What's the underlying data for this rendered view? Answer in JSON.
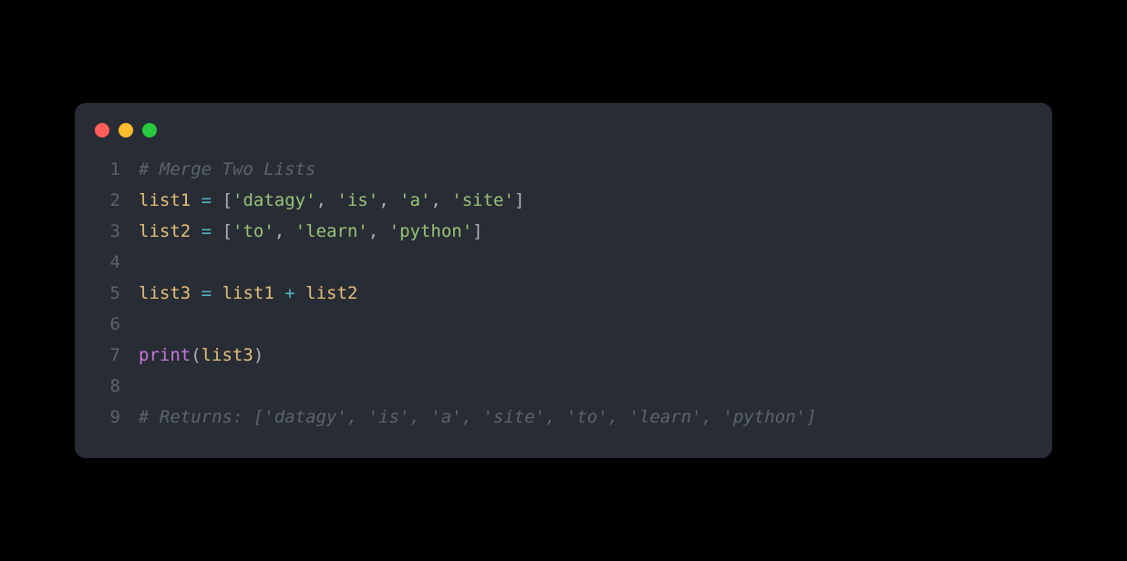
{
  "window": {
    "traffic_lights": [
      "red",
      "yellow",
      "green"
    ]
  },
  "code": {
    "lines": [
      {
        "number": "1",
        "tokens": [
          {
            "type": "comment",
            "text": "# Merge Two Lists"
          }
        ]
      },
      {
        "number": "2",
        "tokens": [
          {
            "type": "variable",
            "text": "list1"
          },
          {
            "type": "plain",
            "text": " "
          },
          {
            "type": "operator",
            "text": "="
          },
          {
            "type": "plain",
            "text": " "
          },
          {
            "type": "bracket",
            "text": "["
          },
          {
            "type": "string",
            "text": "'datagy'"
          },
          {
            "type": "punct",
            "text": ", "
          },
          {
            "type": "string",
            "text": "'is'"
          },
          {
            "type": "punct",
            "text": ", "
          },
          {
            "type": "string",
            "text": "'a'"
          },
          {
            "type": "punct",
            "text": ", "
          },
          {
            "type": "string",
            "text": "'site'"
          },
          {
            "type": "bracket",
            "text": "]"
          }
        ]
      },
      {
        "number": "3",
        "tokens": [
          {
            "type": "variable",
            "text": "list2"
          },
          {
            "type": "plain",
            "text": " "
          },
          {
            "type": "operator",
            "text": "="
          },
          {
            "type": "plain",
            "text": " "
          },
          {
            "type": "bracket",
            "text": "["
          },
          {
            "type": "string",
            "text": "'to'"
          },
          {
            "type": "punct",
            "text": ", "
          },
          {
            "type": "string",
            "text": "'learn'"
          },
          {
            "type": "punct",
            "text": ", "
          },
          {
            "type": "string",
            "text": "'python'"
          },
          {
            "type": "bracket",
            "text": "]"
          }
        ]
      },
      {
        "number": "4",
        "tokens": []
      },
      {
        "number": "5",
        "tokens": [
          {
            "type": "variable",
            "text": "list3"
          },
          {
            "type": "plain",
            "text": " "
          },
          {
            "type": "operator",
            "text": "="
          },
          {
            "type": "plain",
            "text": " "
          },
          {
            "type": "variable",
            "text": "list1"
          },
          {
            "type": "plain",
            "text": " "
          },
          {
            "type": "operator",
            "text": "+"
          },
          {
            "type": "plain",
            "text": " "
          },
          {
            "type": "variable",
            "text": "list2"
          }
        ]
      },
      {
        "number": "6",
        "tokens": []
      },
      {
        "number": "7",
        "tokens": [
          {
            "type": "function",
            "text": "print"
          },
          {
            "type": "paren",
            "text": "("
          },
          {
            "type": "variable",
            "text": "list3"
          },
          {
            "type": "paren",
            "text": ")"
          }
        ]
      },
      {
        "number": "8",
        "tokens": []
      },
      {
        "number": "9",
        "tokens": [
          {
            "type": "comment",
            "text": "# Returns: ['datagy', 'is', 'a', 'site', 'to', 'learn', 'python']"
          }
        ]
      }
    ]
  }
}
